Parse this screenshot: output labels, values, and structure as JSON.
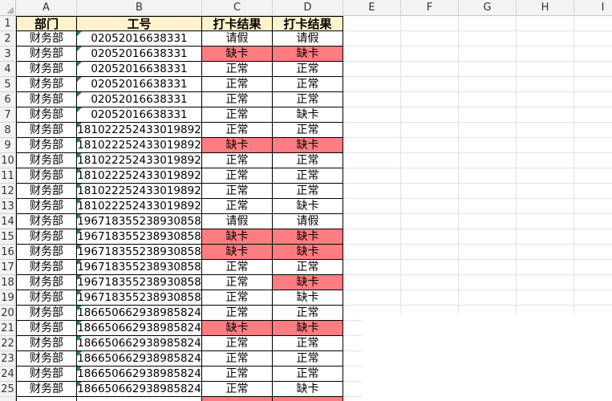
{
  "columns": [
    "A",
    "B",
    "C",
    "D",
    "E",
    "F",
    "G",
    "H",
    "I"
  ],
  "header": [
    "部门",
    "工号",
    "打卡结果",
    "打卡结果"
  ],
  "rows": [
    {
      "num": "2",
      "dept": "财务部",
      "id": "02052016638331",
      "c": "请假",
      "d": "请假",
      "cRed": false,
      "dRed": false
    },
    {
      "num": "3",
      "dept": "财务部",
      "id": "02052016638331",
      "c": "缺卡",
      "d": "缺卡",
      "cRed": true,
      "dRed": true
    },
    {
      "num": "4",
      "dept": "财务部",
      "id": "02052016638331",
      "c": "正常",
      "d": "正常",
      "cRed": false,
      "dRed": false
    },
    {
      "num": "5",
      "dept": "财务部",
      "id": "02052016638331",
      "c": "正常",
      "d": "正常",
      "cRed": false,
      "dRed": false
    },
    {
      "num": "6",
      "dept": "财务部",
      "id": "02052016638331",
      "c": "正常",
      "d": "正常",
      "cRed": false,
      "dRed": false
    },
    {
      "num": "7",
      "dept": "财务部",
      "id": "02052016638331",
      "c": "正常",
      "d": "缺卡",
      "cRed": false,
      "dRed": false
    },
    {
      "num": "8",
      "dept": "财务部",
      "id": "181022252433019892",
      "c": "正常",
      "d": "正常",
      "cRed": false,
      "dRed": false
    },
    {
      "num": "9",
      "dept": "财务部",
      "id": "181022252433019892",
      "c": "缺卡",
      "d": "缺卡",
      "cRed": true,
      "dRed": true
    },
    {
      "num": "10",
      "dept": "财务部",
      "id": "181022252433019892",
      "c": "正常",
      "d": "正常",
      "cRed": false,
      "dRed": false
    },
    {
      "num": "11",
      "dept": "财务部",
      "id": "181022252433019892",
      "c": "正常",
      "d": "正常",
      "cRed": false,
      "dRed": false
    },
    {
      "num": "12",
      "dept": "财务部",
      "id": "181022252433019892",
      "c": "正常",
      "d": "正常",
      "cRed": false,
      "dRed": false
    },
    {
      "num": "13",
      "dept": "财务部",
      "id": "181022252433019892",
      "c": "正常",
      "d": "缺卡",
      "cRed": false,
      "dRed": false
    },
    {
      "num": "14",
      "dept": "财务部",
      "id": "196718355238930858",
      "c": "请假",
      "d": "请假",
      "cRed": false,
      "dRed": false
    },
    {
      "num": "15",
      "dept": "财务部",
      "id": "196718355238930858",
      "c": "缺卡",
      "d": "缺卡",
      "cRed": true,
      "dRed": true
    },
    {
      "num": "16",
      "dept": "财务部",
      "id": "196718355238930858",
      "c": "缺卡",
      "d": "缺卡",
      "cRed": true,
      "dRed": true
    },
    {
      "num": "17",
      "dept": "财务部",
      "id": "196718355238930858",
      "c": "正常",
      "d": "正常",
      "cRed": false,
      "dRed": false
    },
    {
      "num": "18",
      "dept": "财务部",
      "id": "196718355238930858",
      "c": "正常",
      "d": "缺卡",
      "cRed": false,
      "dRed": true
    },
    {
      "num": "19",
      "dept": "财务部",
      "id": "196718355238930858",
      "c": "正常",
      "d": "缺卡",
      "cRed": false,
      "dRed": false
    },
    {
      "num": "20",
      "dept": "财务部",
      "id": "186650662938985824",
      "c": "正常",
      "d": "正常",
      "cRed": false,
      "dRed": false
    },
    {
      "num": "21",
      "dept": "财务部",
      "id": "186650662938985824",
      "c": "缺卡",
      "d": "缺卡",
      "cRed": true,
      "dRed": true
    },
    {
      "num": "22",
      "dept": "财务部",
      "id": "186650662938985824",
      "c": "正常",
      "d": "正常",
      "cRed": false,
      "dRed": false
    },
    {
      "num": "23",
      "dept": "财务部",
      "id": "186650662938985824",
      "c": "正常",
      "d": "正常",
      "cRed": false,
      "dRed": false
    },
    {
      "num": "24",
      "dept": "财务部",
      "id": "186650662938985824",
      "c": "正常",
      "d": "正常",
      "cRed": false,
      "dRed": false
    },
    {
      "num": "25",
      "dept": "财务部",
      "id": "186650662938985824",
      "c": "正常",
      "d": "缺卡",
      "cRed": false,
      "dRed": false
    }
  ],
  "colors": {
    "highlight": "#ff7c80",
    "header_fill": "#fff2cc",
    "flag": "#1e8f3a"
  }
}
